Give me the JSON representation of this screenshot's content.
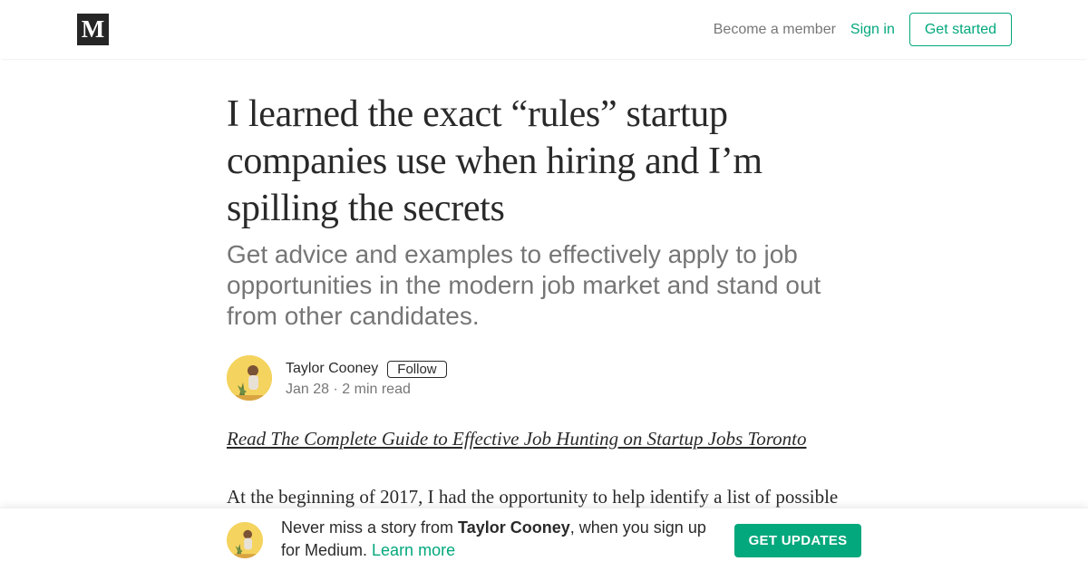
{
  "nav": {
    "logo_text": "M",
    "become_member": "Become a member",
    "sign_in": "Sign in",
    "get_started": "Get started"
  },
  "article": {
    "title": "I learned the exact “rules” startup companies use when hiring and I’m spilling the secrets",
    "subtitle": "Get advice and examples to effectively apply to job opportunities in the modern job market and stand out from other candidates.",
    "author": "Taylor Cooney",
    "follow_label": "Follow",
    "date": "Jan 28",
    "separator": "·",
    "read_time": "2 min read",
    "guide_link": "Read The Complete Guide to Effective Job Hunting on Startup Jobs Toronto",
    "body_first_line": "At the beginning of 2017, I had the opportunity to help identify a list of possible"
  },
  "banner": {
    "text_prefix": "Never miss a story from ",
    "author": "Taylor Cooney",
    "text_suffix": ", when you sign up for Medium. ",
    "learn_more": "Learn more",
    "cta": "GET UPDATES"
  },
  "colors": {
    "accent": "#03a87c",
    "logo_bg": "#262626",
    "avatar_bg": "#f2c94c"
  },
  "icons": {
    "logo": "medium-logo",
    "avatar": "author-avatar"
  }
}
